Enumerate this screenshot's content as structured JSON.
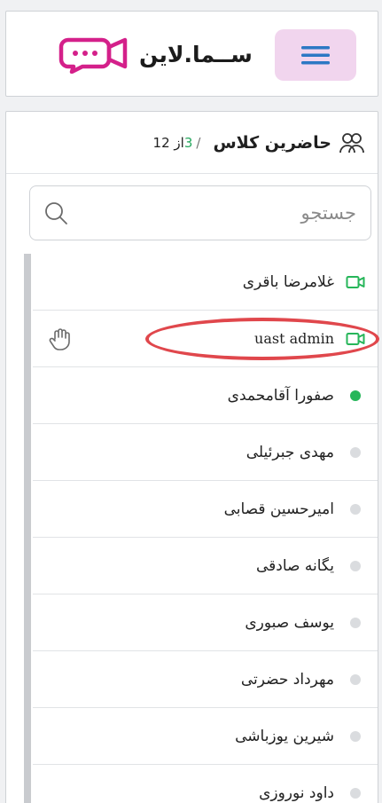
{
  "header": {
    "logo_text": "ســما.لاین",
    "menu_icon": "hamburger-icon",
    "logo_icon": "chat-camera-icon",
    "accent_color": "#d4208a",
    "menu_bg_color": "#f1d5ee"
  },
  "panel": {
    "title": "حاضرین کلاس",
    "count_present": "3",
    "count_sep": "/",
    "count_total": "از 12",
    "search_placeholder": "جستجو"
  },
  "participants": [
    {
      "name": "غلامرضا باقری",
      "status": "camera"
    },
    {
      "name": "uast admin",
      "status": "camera",
      "hand_raised": true
    },
    {
      "name": "صفورا آقامحمدی",
      "status": "online"
    },
    {
      "name": "مهدی جبرئیلی",
      "status": "offline"
    },
    {
      "name": "امیرحسین قصابی",
      "status": "offline"
    },
    {
      "name": "یگانه صادقی",
      "status": "offline"
    },
    {
      "name": "یوسف صبوری",
      "status": "offline"
    },
    {
      "name": "مهرداد حضرتی",
      "status": "offline"
    },
    {
      "name": "شیرین یوزباشی",
      "status": "offline"
    },
    {
      "name": "داود نوروزی",
      "status": "offline"
    }
  ],
  "colors": {
    "online": "#27b65a",
    "offline": "#dadcdf",
    "camera": "#27b65a",
    "highlight": "#e0474c"
  }
}
